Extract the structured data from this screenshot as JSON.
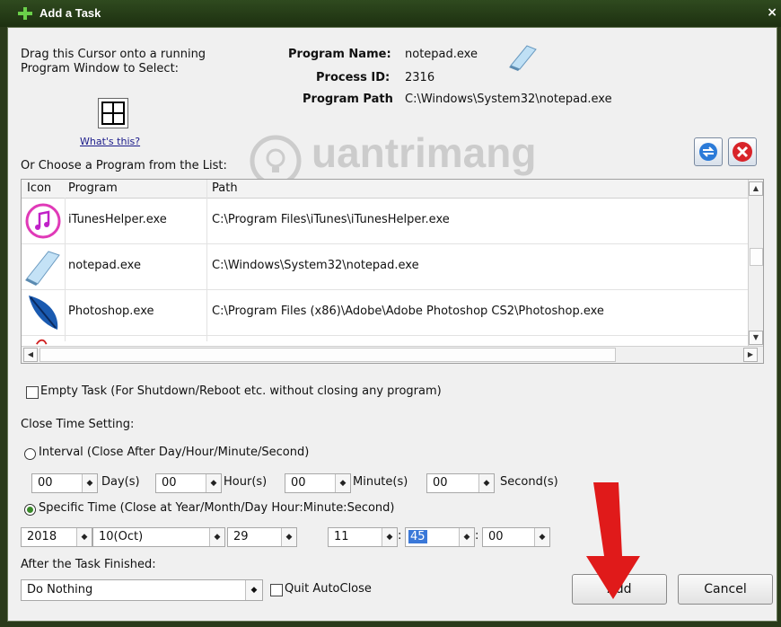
{
  "window": {
    "title": "Add a Task",
    "close_glyph": "×"
  },
  "drag": {
    "instruction_line1": "Drag this Cursor onto a running",
    "instruction_line2": "Program Window to Select:",
    "whats_this": "What's this?"
  },
  "program_info": {
    "name_label": "Program Name:",
    "name_value": "notepad.exe",
    "pid_label": "Process ID:",
    "pid_value": "2316",
    "path_label": "Program Path",
    "path_value": "C:\\Windows\\System32\\notepad.exe"
  },
  "watermark": "uantrimang",
  "list": {
    "label": "Or Choose a Program from the List:",
    "columns": [
      "Icon",
      "Program",
      "Path"
    ],
    "rows": [
      {
        "icon": "itunes-icon",
        "program": "iTunesHelper.exe",
        "path": "C:\\Program Files\\iTunes\\iTunesHelper.exe"
      },
      {
        "icon": "notepad-icon",
        "program": "notepad.exe",
        "path": "C:\\Windows\\System32\\notepad.exe"
      },
      {
        "icon": "photoshop-icon",
        "program": "Photoshop.exe",
        "path": "C:\\Program Files (x86)\\Adobe\\Adobe Photoshop CS2\\Photoshop.exe"
      }
    ]
  },
  "empty_task": {
    "label": "Empty Task (For Shutdown/Reboot etc. without closing any program)",
    "checked": false
  },
  "close_time": {
    "label": "Close Time Setting:",
    "interval": {
      "label": "Interval (Close After Day/Hour/Minute/Second)",
      "selected": false,
      "day": "00",
      "day_unit": "Day(s)",
      "hour": "00",
      "hour_unit": "Hour(s)",
      "minute": "00",
      "minute_unit": "Minute(s)",
      "second": "00",
      "second_unit": "Second(s)"
    },
    "specific": {
      "label": "Specific Time (Close at Year/Month/Day Hour:Minute:Second)",
      "selected": true,
      "year": "2018",
      "month": "10(Oct)",
      "day": "29",
      "hour": "11",
      "minute": "45",
      "second": "00",
      "sep": ":"
    }
  },
  "after": {
    "label": "After the Task Finished:",
    "action": "Do Nothing",
    "quit_label": "Quit AutoClose",
    "quit_checked": false
  },
  "buttons": {
    "add": "Add",
    "cancel": "Cancel"
  },
  "colors": {
    "title_bar": "#1d3010",
    "selection": "#3a78d8",
    "annotation_arrow": "#e01a1a",
    "radio_selected": "#3a8a2a"
  }
}
